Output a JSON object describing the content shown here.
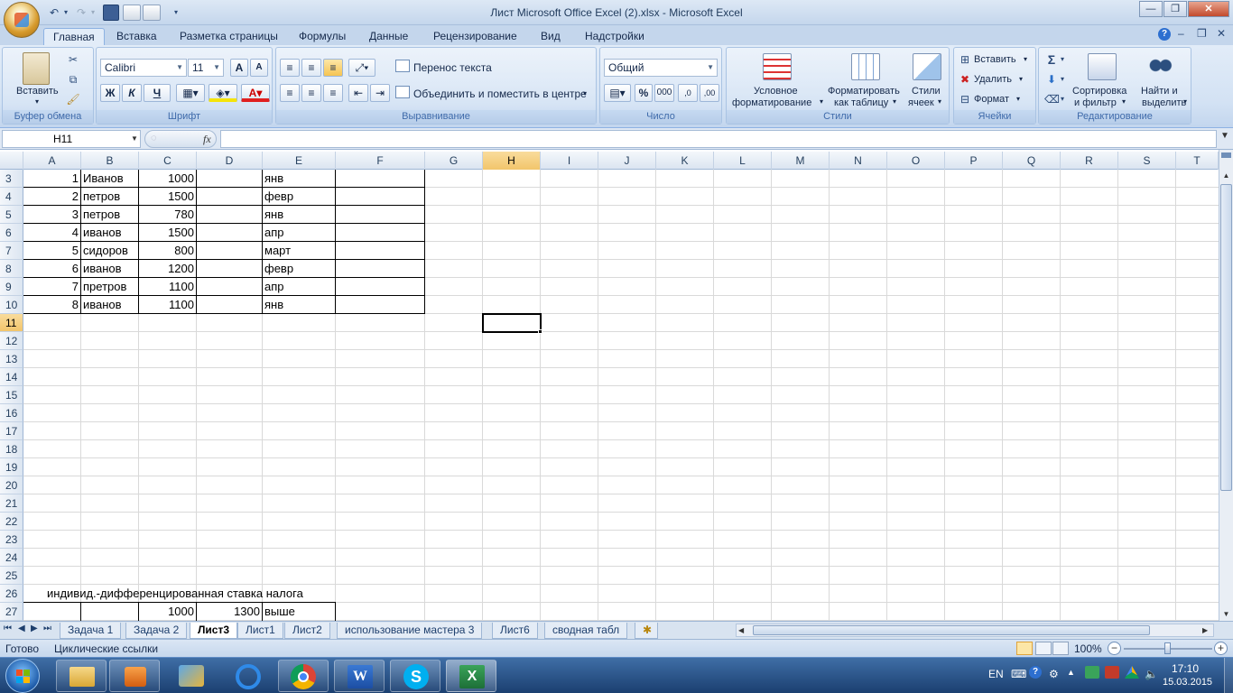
{
  "window": {
    "title": "Лист Microsoft Office Excel (2).xlsx - Microsoft Excel",
    "minimize": "—",
    "maximize": "❐",
    "close": "✕"
  },
  "qat": {
    "undo": "↶",
    "redo": "↷",
    "save": "💾"
  },
  "tabs": [
    "Главная",
    "Вставка",
    "Разметка страницы",
    "Формулы",
    "Данные",
    "Рецензирование",
    "Вид",
    "Надстройки"
  ],
  "tab_active": 0,
  "help_icon": "?",
  "ribbon": {
    "clipboard": {
      "paste": "Вставить",
      "label": "Буфер обмена"
    },
    "font": {
      "name": "Calibri",
      "size": "11",
      "bold": "Ж",
      "italic": "К",
      "underline": "Ч",
      "label": "Шрифт",
      "grow": "A",
      "shrink": "A",
      "color_letter": "A"
    },
    "alignment": {
      "wrap": "Перенос текста",
      "merge": "Объединить и поместить в центре",
      "label": "Выравнивание"
    },
    "number": {
      "format": "Общий",
      "percent": "%",
      "thousands": "000",
      "inc_dec": ",0",
      "dec_dec": ",00",
      "label": "Число"
    },
    "styles": {
      "cond_line1": "Условное",
      "cond_line2": "форматирование",
      "table_line1": "Форматировать",
      "table_line2": "как таблицу",
      "cell_line1": "Стили",
      "cell_line2": "ячеек",
      "label": "Стили"
    },
    "cells": {
      "insert": "Вставить",
      "delete": "Удалить",
      "format": "Формат",
      "label": "Ячейки"
    },
    "editing": {
      "sigma": "Σ",
      "sort_line1": "Сортировка",
      "sort_line2": "и фильтр",
      "find_line1": "Найти и",
      "find_line2": "выделить",
      "label": "Редактирование"
    }
  },
  "formula_bar": {
    "name_box": "H11",
    "fx": "fx",
    "formula": ""
  },
  "columns": [
    "A",
    "B",
    "C",
    "D",
    "E",
    "F",
    "G",
    "H",
    "I",
    "J",
    "K",
    "L",
    "M",
    "N",
    "O",
    "P",
    "Q",
    "R",
    "S",
    "T"
  ],
  "selected_column": "H",
  "rows": [
    "3",
    "4",
    "5",
    "6",
    "7",
    "8",
    "9",
    "10",
    "11",
    "12",
    "13",
    "14",
    "15",
    "16",
    "17",
    "18",
    "19",
    "20",
    "21",
    "22",
    "23",
    "24",
    "25",
    "26",
    "27"
  ],
  "selected_row": "11",
  "table": [
    {
      "a": "1",
      "b": "Иванов",
      "c": "1000",
      "e": "янв"
    },
    {
      "a": "2",
      "b": "петров",
      "c": "1500",
      "e": "февр"
    },
    {
      "a": "3",
      "b": "петров",
      "c": "780",
      "e": "янв"
    },
    {
      "a": "4",
      "b": "иванов",
      "c": "1500",
      "e": "апр"
    },
    {
      "a": "5",
      "b": "сидоров",
      "c": "800",
      "e": "март"
    },
    {
      "a": "6",
      "b": "иванов",
      "c": "1200",
      "e": "февр"
    },
    {
      "a": "7",
      "b": "претров",
      "c": "1100",
      "e": "апр"
    },
    {
      "a": "8",
      "b": "иванов",
      "c": "1100",
      "e": "янв"
    }
  ],
  "row26_text": "индивид.-дифференцированная ставка налога",
  "row27": {
    "c": "1000",
    "d": "1300",
    "e": "выше"
  },
  "sheet_nav": [
    "⏮",
    "◀",
    "▶",
    "⏭"
  ],
  "sheets": [
    "Задача 1",
    "Задача 2",
    "Лист3",
    "Лист1",
    "Лист2",
    "использование мастера 3",
    "Лист6",
    "сводная табл"
  ],
  "active_sheet": "Лист3",
  "status": {
    "ready": "Готово",
    "circular": "Циклические ссылки",
    "zoom": "100%"
  },
  "tray": {
    "lang": "EN",
    "time": "17:10",
    "date": "15.03.2015"
  }
}
